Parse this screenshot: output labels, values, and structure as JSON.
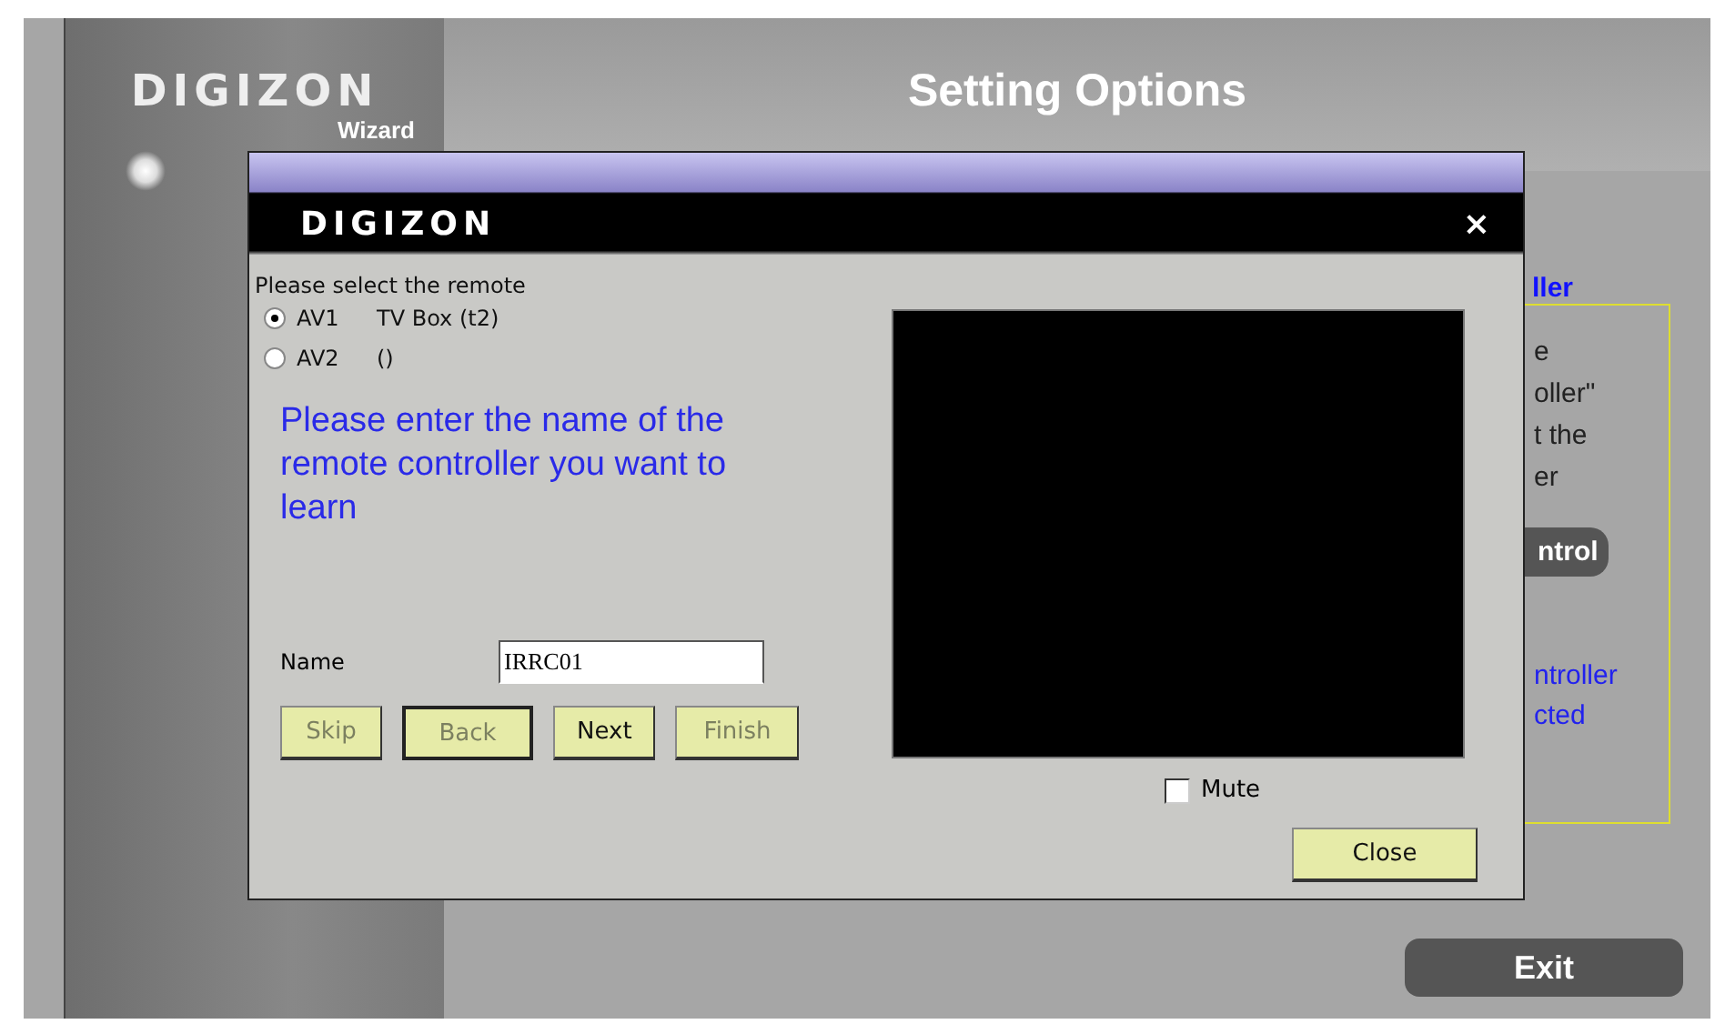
{
  "app": {
    "logo": "DIGIZON",
    "logo_subtitle": "Wizard",
    "title": "Setting Options",
    "exit_button": "Exit"
  },
  "background_panel": {
    "heading": "ller",
    "lines": [
      "e",
      "oller\"",
      "t the",
      "er"
    ],
    "button": "ntrol",
    "status_lines": [
      "ntroller",
      "cted"
    ]
  },
  "dialog": {
    "logo": "DIGIZON",
    "close": "×",
    "prompt": "Please select the remote",
    "remotes": [
      {
        "label": "AV1",
        "device": "TV Box (t2)",
        "selected": true
      },
      {
        "label": "AV2",
        "device": "()",
        "selected": false
      }
    ],
    "instruction": "Please enter the name of the remote controller you want to learn",
    "name_label": "Name",
    "name_value": "IRRC01",
    "buttons": [
      {
        "label": "Skip",
        "disabled": true,
        "focused": false
      },
      {
        "label": "Back",
        "disabled": true,
        "focused": true
      },
      {
        "label": "Next",
        "disabled": false,
        "focused": false
      },
      {
        "label": "Finish",
        "disabled": true,
        "focused": false
      }
    ],
    "mute": {
      "label": "Mute",
      "checked": false
    },
    "close_button": "Close"
  }
}
